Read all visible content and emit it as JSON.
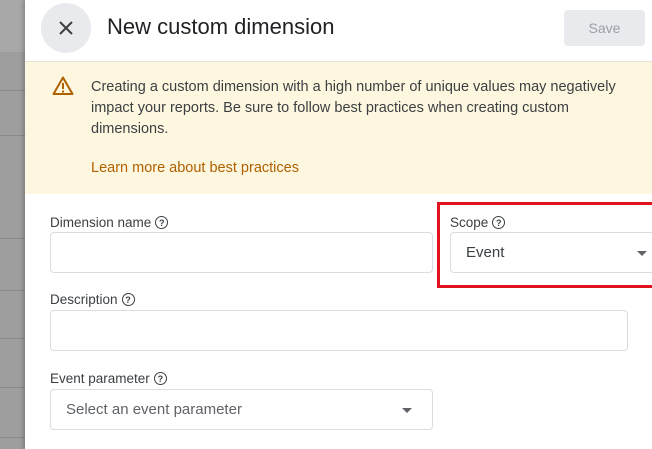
{
  "header": {
    "title": "New custom dimension",
    "save_label": "Save",
    "close_icon": "close-icon"
  },
  "banner": {
    "text": "Creating a custom dimension with a high number of unique values may negatively impact your reports. Be sure to follow best practices when creating custom dimensions.",
    "link": "Learn more about best practices",
    "icon": "warning-icon",
    "bg": "#fef7e0",
    "link_color": "#b06000"
  },
  "form": {
    "dimension_name": {
      "label": "Dimension name",
      "value": ""
    },
    "scope": {
      "label": "Scope",
      "value": "Event"
    },
    "description": {
      "label": "Description",
      "value": ""
    },
    "event_parameter": {
      "label": "Event parameter",
      "placeholder": "Select an event parameter"
    }
  },
  "highlight_color": "#e0121c"
}
